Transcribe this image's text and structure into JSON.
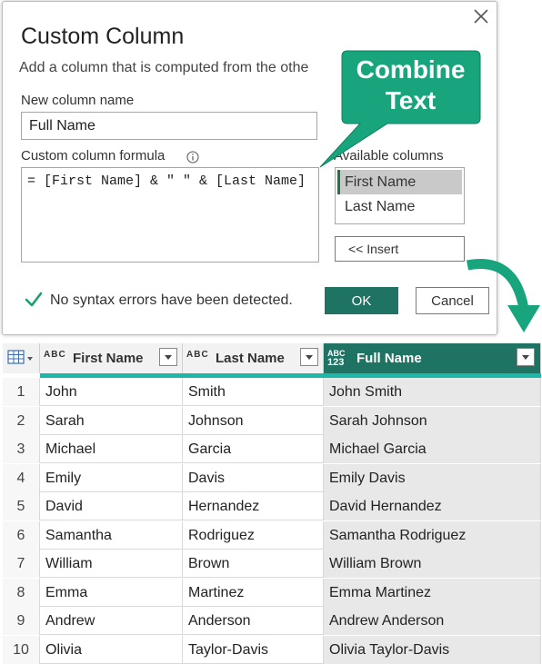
{
  "dialog": {
    "title": "Custom Column",
    "subtitle": "Add a column that is computed from the othe",
    "new_column_label": "New column name",
    "new_column_value": "Full Name",
    "formula_label": "Custom column formula",
    "formula": "= [First Name] & \" \" & [Last Name]",
    "available_label": "Available columns",
    "available_columns": [
      "First Name",
      "Last Name"
    ],
    "selected_column": "First Name",
    "insert_label": "<< Insert",
    "status": "No syntax errors have been detected.",
    "ok_label": "OK",
    "cancel_label": "Cancel"
  },
  "callout": {
    "line1": "Combine",
    "line2": "Text",
    "color": "#18a57e"
  },
  "table": {
    "headers": {
      "col1": "First Name",
      "col2": "Last Name",
      "col3": "Full Name",
      "type_text": "ABC",
      "type_any_top": "ABC",
      "type_any_bottom": "123"
    },
    "rows": [
      [
        "1",
        "John",
        "Smith",
        "John Smith"
      ],
      [
        "2",
        "Sarah",
        "Johnson",
        "Sarah Johnson"
      ],
      [
        "3",
        "Michael",
        "Garcia",
        "Michael Garcia"
      ],
      [
        "4",
        "Emily",
        "Davis",
        "Emily Davis"
      ],
      [
        "5",
        "David",
        "Hernandez",
        "David Hernandez"
      ],
      [
        "6",
        "Samantha",
        "Rodriguez",
        "Samantha Rodriguez"
      ],
      [
        "7",
        "William",
        "Brown",
        "William Brown"
      ],
      [
        "8",
        "Emma",
        "Martinez",
        "Emma Martinez"
      ],
      [
        "9",
        "Andrew",
        "Anderson",
        "Andrew Anderson"
      ],
      [
        "10",
        "Olivia",
        "Taylor-Davis",
        "Olivia Taylor-Davis"
      ]
    ]
  },
  "colors": {
    "accent": "#1e7363",
    "highlight_bar": "#1db8a8",
    "check": "#1e9e6a"
  },
  "icons": [
    "close-icon",
    "info-icon",
    "check-icon",
    "table-icon",
    "text-type-icon",
    "any-type-icon",
    "chevron-down-icon",
    "curved-arrow-icon"
  ]
}
